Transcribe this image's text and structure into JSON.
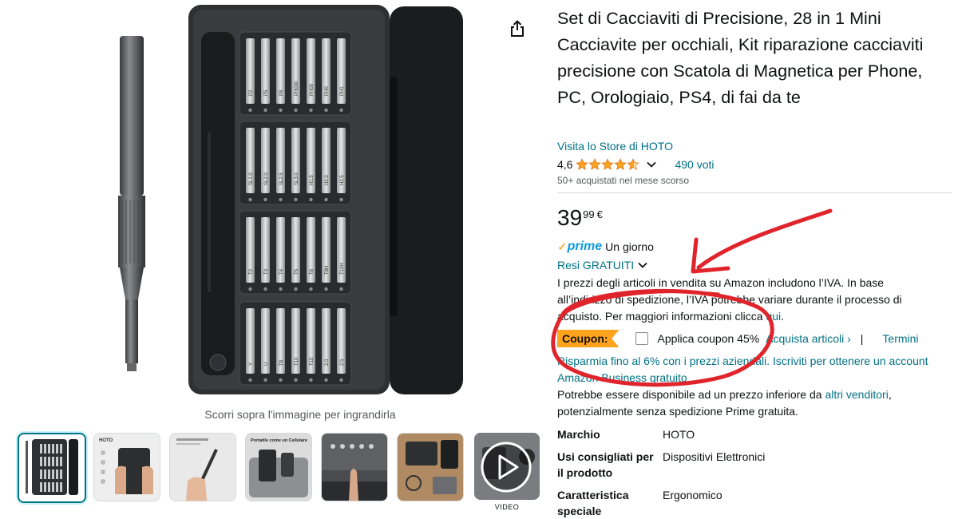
{
  "product": {
    "title": "Set di Cacciaviti di Precisione, 28 in 1 Mini Cacciavite per occhiali, Kit riparazione cacciaviti precisione con Scatola di Magnetica per Phone, PC, Orologiaio, PS4, di fai da te",
    "store_link": "Visita lo Store di HOTO",
    "rating": "4,6",
    "rating_value": 4.6,
    "votes": "490 voti",
    "bought": "50+ acquistati nel mese scorso",
    "price_whole": "39",
    "price_fraction": "99",
    "currency": "€"
  },
  "delivery": {
    "prime_check": "✓",
    "prime_label": "prime",
    "prime_speed": "Un giorno",
    "returns": "Resi GRATUITI"
  },
  "vat": {
    "text": "I prezzi degli articoli in vendita su Amazon includono l’IVA. In base all’indirizzo di spedizione, l’IVA potrebbe variare durante il processo di acquisto. Per maggiori informazioni clicca ",
    "link": "qui",
    "end": "."
  },
  "coupon": {
    "badge": "Coupon:",
    "apply": "Applica coupon 45%",
    "shop_items": "Acquista articoli ›",
    "separator": "|",
    "terms": "Termini"
  },
  "business": "Risparmia fino al 6% con i prezzi aziendali. Iscriviti per ottenere un account Amazon Business gratuito",
  "other_sellers": {
    "pre": "Potrebbe essere disponibile ad un prezzo inferiore da ",
    "link": "altri venditori",
    "post": ", potenzialmente senza spedizione Prime gratuita."
  },
  "specs": [
    {
      "key": "Marchio",
      "value": "HOTO"
    },
    {
      "key": "Usi consigliati per il prodotto",
      "value": "Dispositivi Elettronici"
    },
    {
      "key": "Caratteristica speciale",
      "value": "Ergonomico"
    }
  ],
  "gallery": {
    "hover_hint": "Scorri sopra l'immagine per ingrandirla",
    "thumb_brand": "HOTO",
    "thumb_caption": "Portatile come un Cellulare",
    "video_label": "VIDEO"
  },
  "bit_labels": [
    [
      "P2",
      "P5",
      "P6",
      "PH000",
      "PH00",
      "PH0",
      "PH1"
    ],
    [
      "SL1.0",
      "SL2.0",
      "SL2.5",
      "SL3.0",
      "H1.5",
      "H2.0",
      "H2.5"
    ],
    [
      "T2",
      "T3",
      "T4",
      "T5",
      "T6",
      "T8H",
      "T10H"
    ],
    [
      "Y",
      "U",
      "T8",
      "T10",
      "T15",
      "2.0",
      "2.5"
    ]
  ],
  "colors": {
    "link": "#007185",
    "coupon": "#ffa41c",
    "prime": "#0a9bd8",
    "star": "#ffa41c",
    "annotation": "#e0242b"
  }
}
